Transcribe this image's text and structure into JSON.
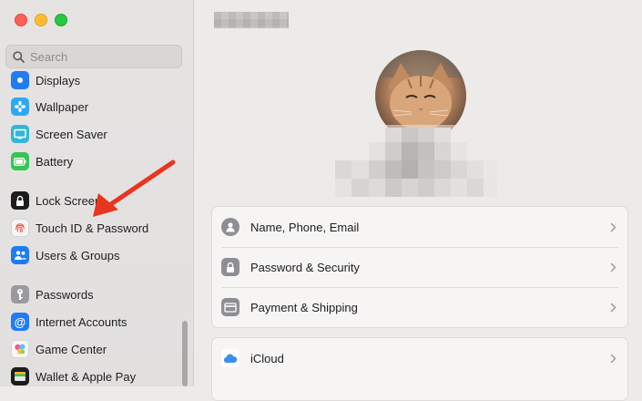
{
  "window": {
    "traffic_lights": [
      "close",
      "minimize",
      "zoom"
    ],
    "colors": {
      "close": "#fe5f57",
      "minimize": "#febc2e",
      "zoom": "#28c840"
    }
  },
  "sidebar": {
    "search": {
      "placeholder": "Search",
      "value": ""
    },
    "items": [
      {
        "label": "Displays",
        "icon": "displays-icon"
      },
      {
        "label": "Wallpaper",
        "icon": "wallpaper-icon"
      },
      {
        "label": "Screen Saver",
        "icon": "screen-saver-icon"
      },
      {
        "label": "Battery",
        "icon": "battery-icon"
      },
      {
        "label": "Lock Screen",
        "icon": "lock-icon"
      },
      {
        "label": "Touch ID & Password",
        "icon": "fingerprint-icon"
      },
      {
        "label": "Users & Groups",
        "icon": "users-icon"
      },
      {
        "label": "Passwords",
        "icon": "key-icon"
      },
      {
        "label": "Internet Accounts",
        "icon": "at-icon"
      },
      {
        "label": "Game Center",
        "icon": "game-center-icon"
      },
      {
        "label": "Wallet & Apple Pay",
        "icon": "wallet-icon"
      }
    ]
  },
  "main": {
    "account_rows": [
      {
        "label": "Name, Phone, Email",
        "icon": "person-icon"
      },
      {
        "label": "Password & Security",
        "icon": "lock-icon"
      },
      {
        "label": "Payment & Shipping",
        "icon": "card-icon"
      }
    ],
    "service_rows": [
      {
        "label": "iCloud",
        "icon": "icloud-icon"
      }
    ]
  },
  "annotation": {
    "arrow_color": "#e8351f"
  }
}
